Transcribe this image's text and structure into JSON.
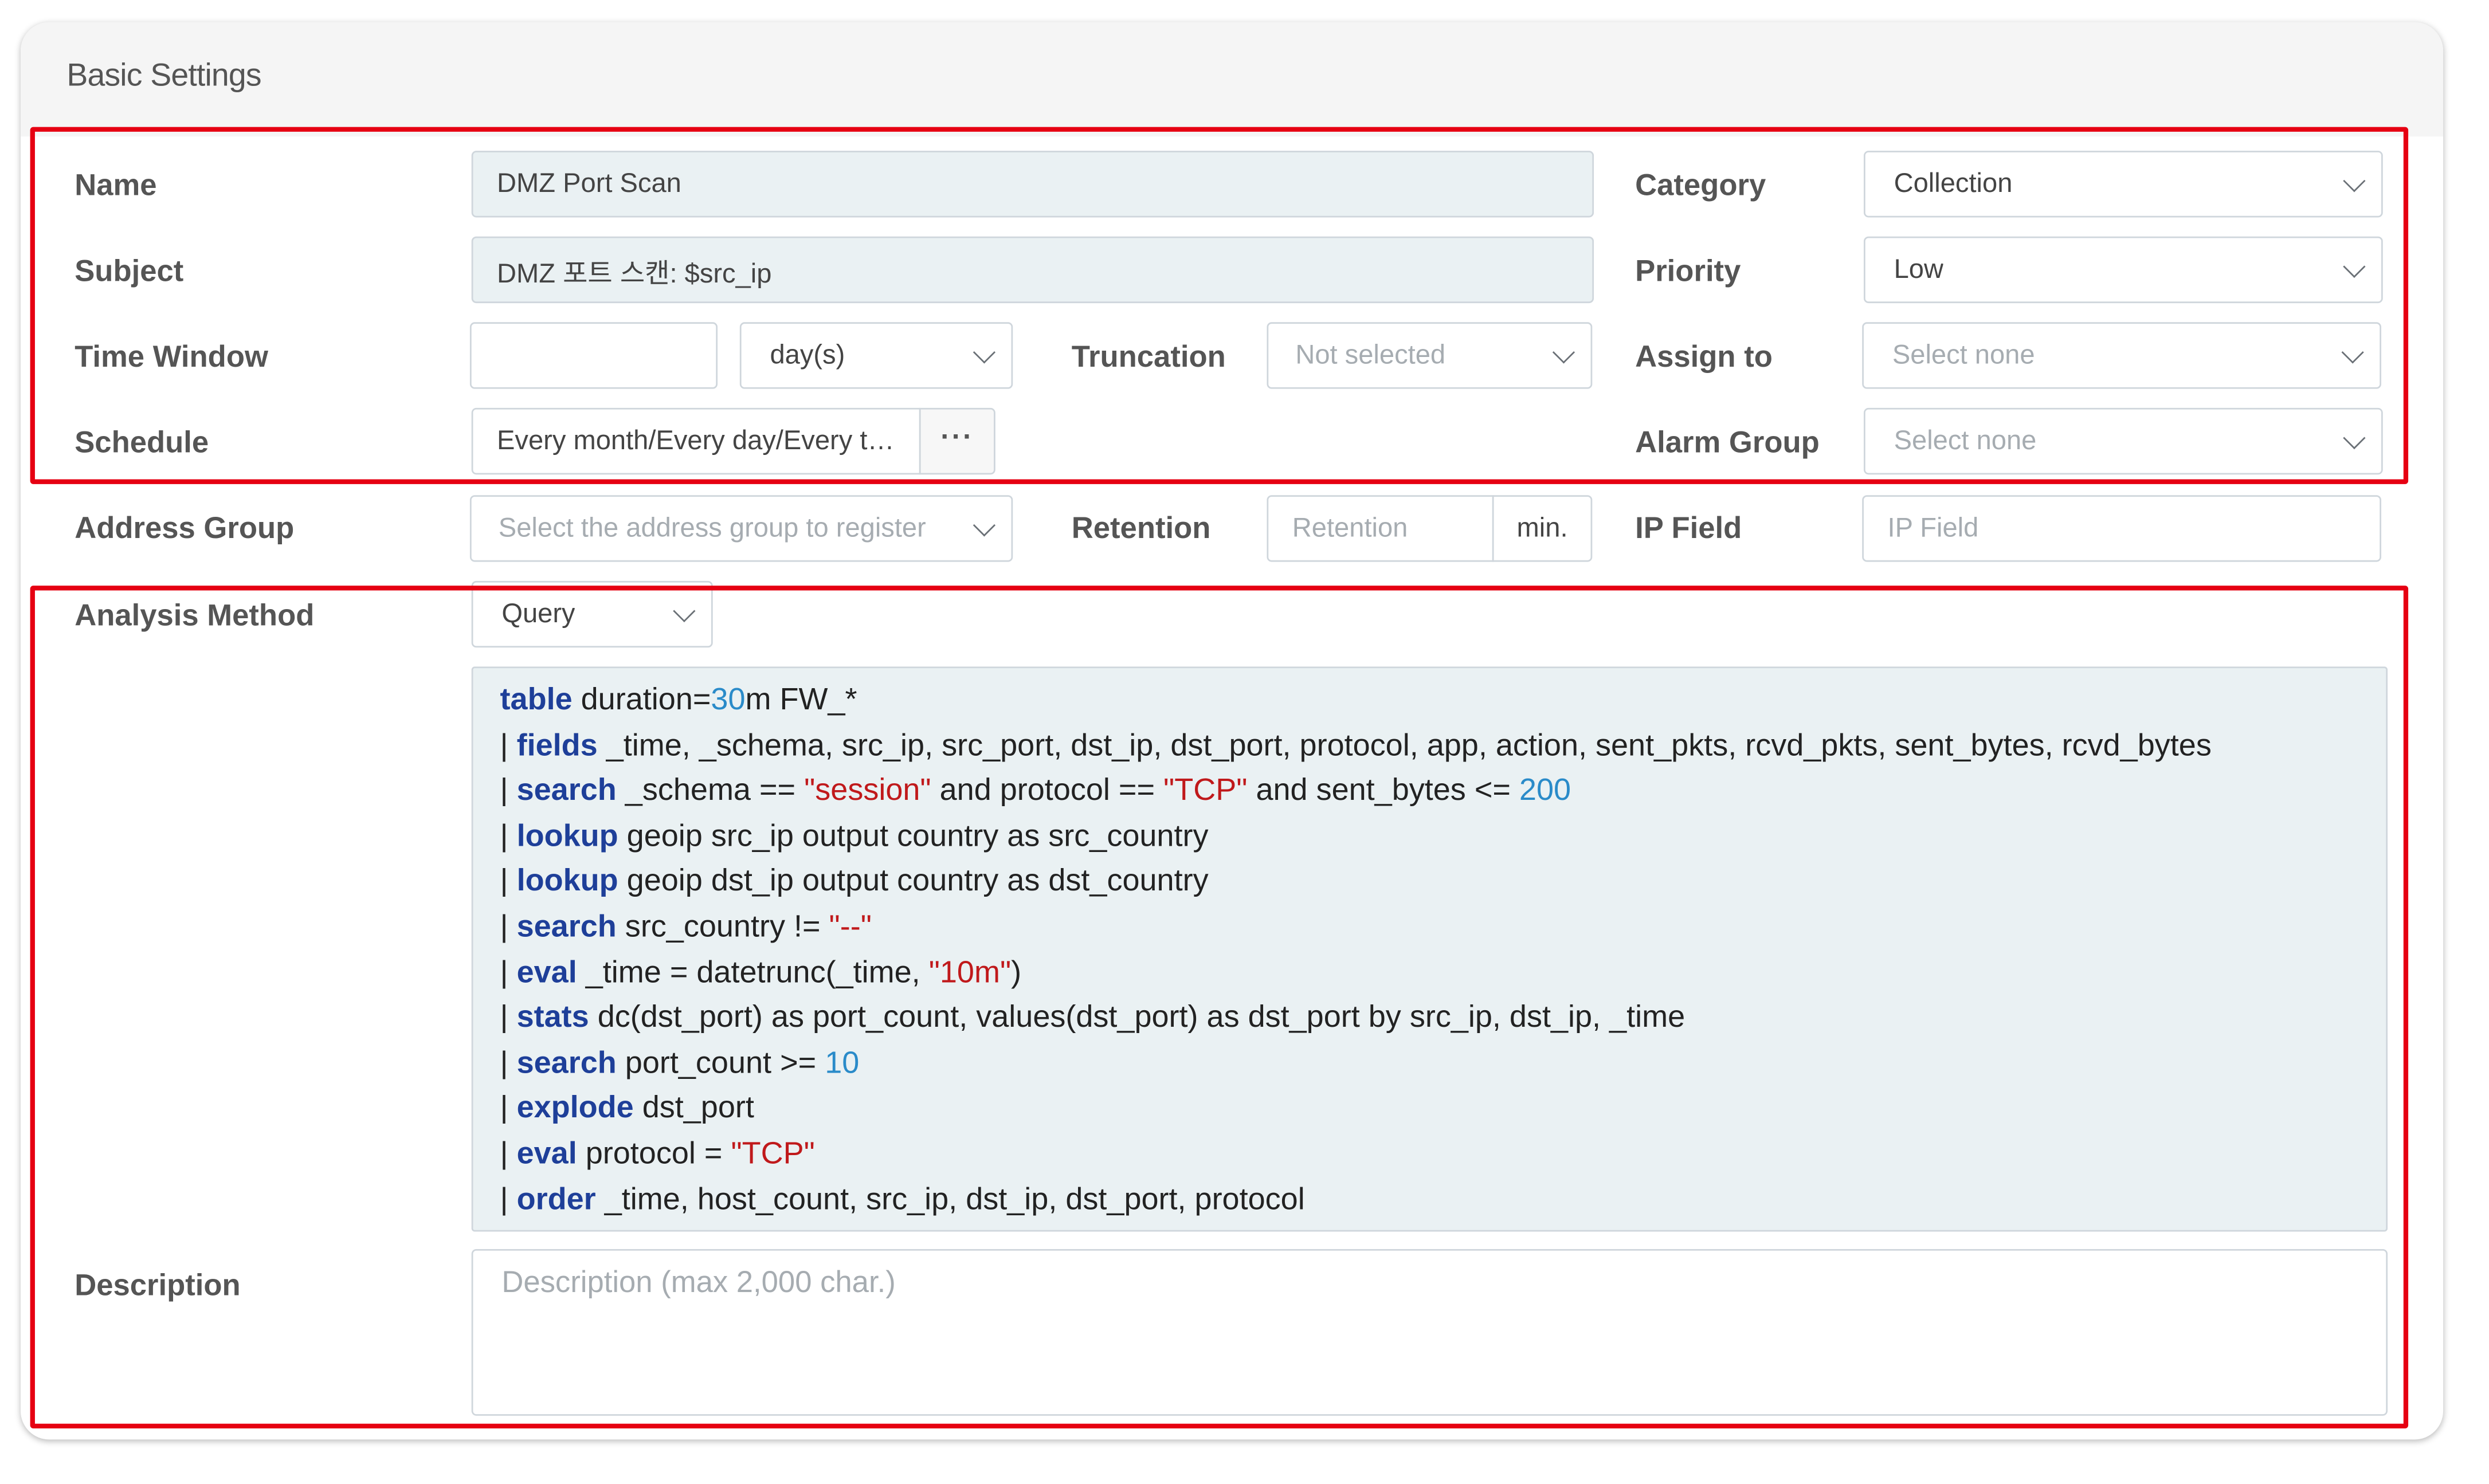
{
  "panel": {
    "title": "Basic Settings"
  },
  "labels": {
    "name": "Name",
    "subject": "Subject",
    "time_window": "Time Window",
    "schedule": "Schedule",
    "address_group": "Address Group",
    "analysis_method": "Analysis Method",
    "description": "Description",
    "truncation": "Truncation",
    "retention": "Retention",
    "category": "Category",
    "priority": "Priority",
    "assign_to": "Assign to",
    "alarm_group": "Alarm Group",
    "ip_field": "IP Field"
  },
  "fields": {
    "name_value": "DMZ Port Scan",
    "subject_value": "DMZ 포트 스캔: $src_ip",
    "time_window_value": "",
    "time_window_unit": "day(s)",
    "truncation_value": "Not selected",
    "schedule_value": "Every month/Every day/Every time",
    "schedule_button": "···",
    "address_group_placeholder": "Select the address group to register",
    "retention_placeholder": "Retention",
    "retention_unit": "min.",
    "category_value": "Collection",
    "priority_value": "Low",
    "assign_to_placeholder": "Select none",
    "alarm_group_placeholder": "Select none",
    "ip_field_placeholder": "IP Field",
    "analysis_method_value": "Query",
    "description_placeholder": "Description (max 2,000 char.)"
  },
  "query_lines": [
    [
      [
        "kw",
        "table"
      ],
      [
        "t",
        " duration="
      ],
      [
        "num",
        "30"
      ],
      [
        "t",
        "m FW_*"
      ]
    ],
    [
      [
        "t",
        "| "
      ],
      [
        "kw",
        "fields"
      ],
      [
        "t",
        " _time, _schema, src_ip, src_port, dst_ip, dst_port, protocol, app, action, sent_pkts, rcvd_pkts, sent_bytes, rcvd_bytes"
      ]
    ],
    [
      [
        "t",
        "| "
      ],
      [
        "kw",
        "search"
      ],
      [
        "t",
        " _schema == "
      ],
      [
        "str",
        "\"session\""
      ],
      [
        "t",
        " and protocol == "
      ],
      [
        "str",
        "\"TCP\""
      ],
      [
        "t",
        " and sent_bytes <= "
      ],
      [
        "num",
        "200"
      ]
    ],
    [
      [
        "t",
        "| "
      ],
      [
        "kw",
        "lookup"
      ],
      [
        "t",
        " geoip src_ip output country as src_country"
      ]
    ],
    [
      [
        "t",
        "| "
      ],
      [
        "kw",
        "lookup"
      ],
      [
        "t",
        " geoip dst_ip output country as dst_country"
      ]
    ],
    [
      [
        "t",
        "| "
      ],
      [
        "kw",
        "search"
      ],
      [
        "t",
        " src_country != "
      ],
      [
        "str",
        "\"--\""
      ]
    ],
    [
      [
        "t",
        "| "
      ],
      [
        "kw",
        "eval"
      ],
      [
        "t",
        " _time = datetrunc(_time, "
      ],
      [
        "str",
        "\"10m\""
      ],
      [
        "t",
        ")"
      ]
    ],
    [
      [
        "t",
        "| "
      ],
      [
        "kw",
        "stats"
      ],
      [
        "t",
        " dc(dst_port) as port_count, values(dst_port) as dst_port by src_ip, dst_ip, _time"
      ]
    ],
    [
      [
        "t",
        "| "
      ],
      [
        "kw",
        "search"
      ],
      [
        "t",
        " port_count >= "
      ],
      [
        "num",
        "10"
      ]
    ],
    [
      [
        "t",
        "| "
      ],
      [
        "kw",
        "explode"
      ],
      [
        "t",
        " dst_port"
      ]
    ],
    [
      [
        "t",
        "| "
      ],
      [
        "kw",
        "eval"
      ],
      [
        "t",
        " protocol = "
      ],
      [
        "str",
        "\"TCP\""
      ]
    ],
    [
      [
        "t",
        "| "
      ],
      [
        "kw",
        "order"
      ],
      [
        "t",
        " _time, host_count, src_ip, dst_ip, dst_port, protocol"
      ]
    ]
  ],
  "colors": {
    "highlight_border": "#e60012",
    "keyword": "#1e3f99",
    "string": "#c0191b",
    "number": "#2a8bc9",
    "readonly_field": "#eaf1f3"
  }
}
